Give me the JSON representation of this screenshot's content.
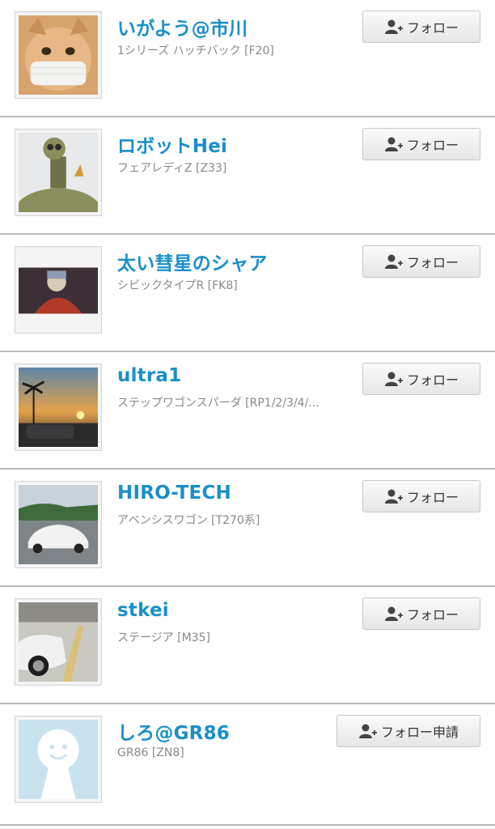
{
  "users": [
    {
      "name": "いがよう@市川",
      "car": "1シリーズ ハッチバック [F20]",
      "button": "フォロー"
    },
    {
      "name": "ロボットHei",
      "car": "フェアレディZ [Z33]",
      "button": "フォロー"
    },
    {
      "name": "太い彗星のシャア",
      "car": "シビックタイプR [FK8]",
      "button": "フォロー"
    },
    {
      "name": "ultra1",
      "car": "ステップワゴンスパーダ [RP1/2/3/4/...",
      "button": "フォロー"
    },
    {
      "name": "HIRO-TECH",
      "car": "アベンシスワゴン [T270系]",
      "button": "フォロー"
    },
    {
      "name": "stkei",
      "car": "ステージア [M35]",
      "button": "フォロー"
    },
    {
      "name": "しろ@GR86",
      "car": "GR86 [ZN8]",
      "button": "フォロー申請"
    }
  ],
  "colors": {
    "name": "#1a8fc9",
    "subtext": "#8a8a8a",
    "divider": "#b9b9b9"
  }
}
